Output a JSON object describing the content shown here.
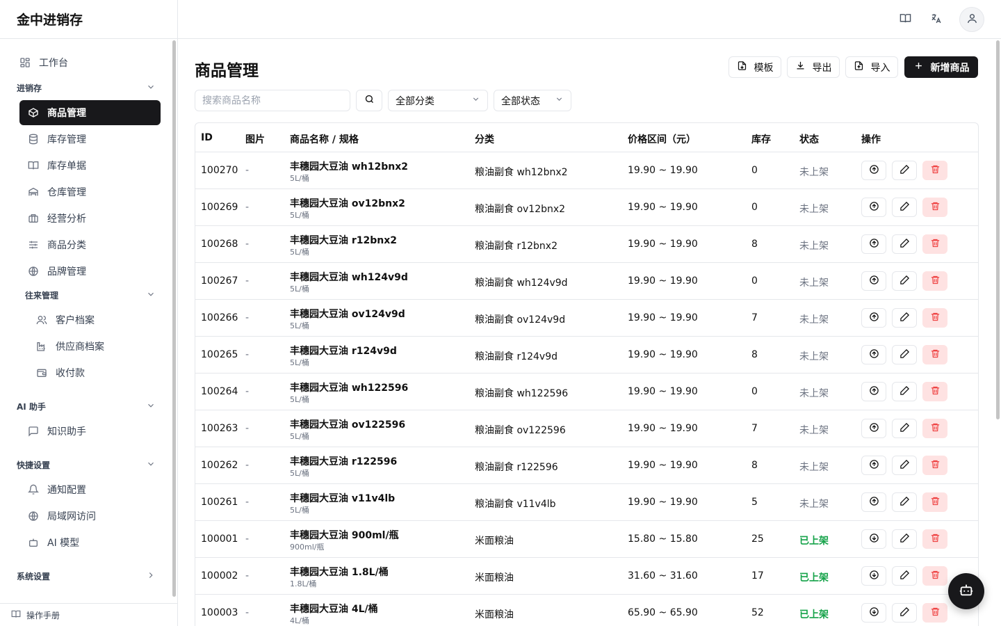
{
  "app": {
    "brand": "金中进销存"
  },
  "sidebar": {
    "workbench": "工作台",
    "group_jxc": "进销存",
    "items": [
      {
        "label": "商品管理",
        "icon": "package-icon",
        "active": true
      },
      {
        "label": "库存管理",
        "icon": "database-icon"
      },
      {
        "label": "库存单据",
        "icon": "book-icon"
      },
      {
        "label": "仓库管理",
        "icon": "warehouse-icon"
      },
      {
        "label": "经营分析",
        "icon": "briefcase-icon"
      },
      {
        "label": "商品分类",
        "icon": "sliders-icon"
      },
      {
        "label": "品牌管理",
        "icon": "globe-icon"
      }
    ],
    "group_contacts": "往来管理",
    "contacts": [
      {
        "label": "客户档案",
        "icon": "users-icon"
      },
      {
        "label": "供应商档案",
        "icon": "factory-icon"
      },
      {
        "label": "收付款",
        "icon": "wallet-icon"
      }
    ],
    "group_ai": "AI 助手",
    "ai_items": [
      {
        "label": "知识助手",
        "icon": "message-icon"
      }
    ],
    "group_quick": "快捷设置",
    "quick_items": [
      {
        "label": "通知配置",
        "icon": "bell-icon"
      },
      {
        "label": "局域网访问",
        "icon": "globe-icon"
      },
      {
        "label": "AI 模型",
        "icon": "bot-icon"
      }
    ],
    "group_system": "系统设置",
    "manual": "操作手册"
  },
  "topbar": {
    "icons": [
      "book-icon",
      "translate-icon",
      "user-icon"
    ]
  },
  "page": {
    "title": "商品管理",
    "buttons": {
      "template": "模板",
      "export": "导出",
      "import": "导入",
      "add": "新增商品"
    },
    "search_placeholder": "搜索商品名称",
    "filter_category": "全部分类",
    "filter_status": "全部状态"
  },
  "table": {
    "headers": [
      "ID",
      "图片",
      "商品名称 / 规格",
      "分类",
      "价格区间（元）",
      "库存",
      "状态",
      "操作"
    ],
    "rows": [
      {
        "id": "100270",
        "img": "-",
        "name": "丰穗园大豆油 wh12bnx2",
        "spec": "5L/桶",
        "category": "粮油副食 wh12bnx2",
        "price": "19.90 ~ 19.90",
        "stock": "0",
        "status": "未上架",
        "on": false
      },
      {
        "id": "100269",
        "img": "-",
        "name": "丰穗园大豆油 ov12bnx2",
        "spec": "5L/桶",
        "category": "粮油副食 ov12bnx2",
        "price": "19.90 ~ 19.90",
        "stock": "0",
        "status": "未上架",
        "on": false
      },
      {
        "id": "100268",
        "img": "-",
        "name": "丰穗园大豆油 r12bnx2",
        "spec": "5L/桶",
        "category": "粮油副食 r12bnx2",
        "price": "19.90 ~ 19.90",
        "stock": "8",
        "status": "未上架",
        "on": false
      },
      {
        "id": "100267",
        "img": "-",
        "name": "丰穗园大豆油 wh124v9d",
        "spec": "5L/桶",
        "category": "粮油副食 wh124v9d",
        "price": "19.90 ~ 19.90",
        "stock": "0",
        "status": "未上架",
        "on": false
      },
      {
        "id": "100266",
        "img": "-",
        "name": "丰穗园大豆油 ov124v9d",
        "spec": "5L/桶",
        "category": "粮油副食 ov124v9d",
        "price": "19.90 ~ 19.90",
        "stock": "7",
        "status": "未上架",
        "on": false
      },
      {
        "id": "100265",
        "img": "-",
        "name": "丰穗园大豆油 r124v9d",
        "spec": "5L/桶",
        "category": "粮油副食 r124v9d",
        "price": "19.90 ~ 19.90",
        "stock": "8",
        "status": "未上架",
        "on": false
      },
      {
        "id": "100264",
        "img": "-",
        "name": "丰穗园大豆油 wh122596",
        "spec": "5L/桶",
        "category": "粮油副食 wh122596",
        "price": "19.90 ~ 19.90",
        "stock": "0",
        "status": "未上架",
        "on": false
      },
      {
        "id": "100263",
        "img": "-",
        "name": "丰穗园大豆油 ov122596",
        "spec": "5L/桶",
        "category": "粮油副食 ov122596",
        "price": "19.90 ~ 19.90",
        "stock": "7",
        "status": "未上架",
        "on": false
      },
      {
        "id": "100262",
        "img": "-",
        "name": "丰穗园大豆油 r122596",
        "spec": "5L/桶",
        "category": "粮油副食 r122596",
        "price": "19.90 ~ 19.90",
        "stock": "8",
        "status": "未上架",
        "on": false
      },
      {
        "id": "100261",
        "img": "-",
        "name": "丰穗园大豆油 v11v4lb",
        "spec": "5L/桶",
        "category": "粮油副食 v11v4lb",
        "price": "19.90 ~ 19.90",
        "stock": "5",
        "status": "未上架",
        "on": false
      },
      {
        "id": "100001",
        "img": "-",
        "name": "丰穗园大豆油 900ml/瓶",
        "spec": "900ml/瓶",
        "category": "米面粮油",
        "price": "15.80 ~ 15.80",
        "stock": "25",
        "status": "已上架",
        "on": true
      },
      {
        "id": "100002",
        "img": "-",
        "name": "丰穗园大豆油 1.8L/桶",
        "spec": "1.8L/桶",
        "category": "米面粮油",
        "price": "31.60 ~ 31.60",
        "stock": "17",
        "status": "已上架",
        "on": true
      },
      {
        "id": "100003",
        "img": "-",
        "name": "丰穗园大豆油 4L/桶",
        "spec": "4L/桶",
        "category": "米面粮油",
        "price": "65.90 ~ 65.90",
        "stock": "52",
        "status": "已上架",
        "on": true
      }
    ]
  },
  "colors": {
    "primary": "#18181b",
    "on_status": "#16a34a",
    "delete": "#ef4444",
    "border": "#e5e7eb"
  }
}
